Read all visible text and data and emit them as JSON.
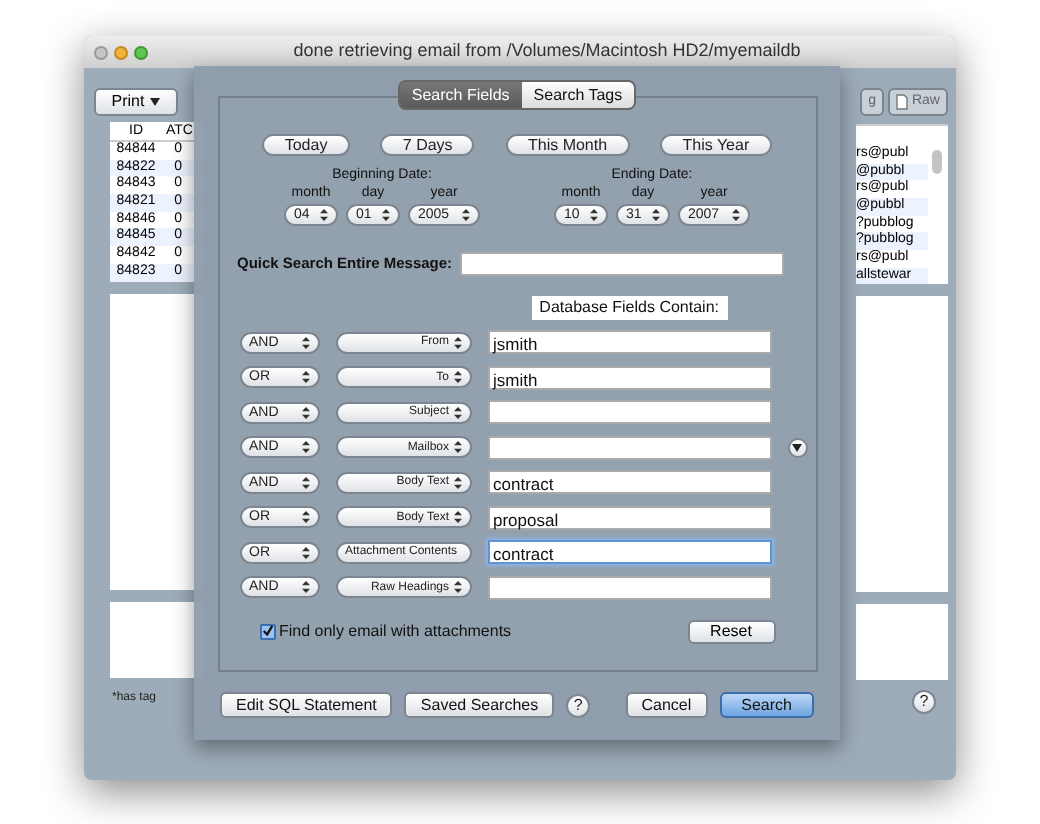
{
  "window": {
    "title": "done retrieving email from /Volumes/Macintosh HD2/myemaildb"
  },
  "toolbar": {
    "left_buttons": [
      {
        "label": "Print"
      }
    ],
    "right_buttons": [
      {
        "label": "g",
        "has_icon": false
      },
      {
        "label": "Raw",
        "has_icon": true
      }
    ]
  },
  "messages": {
    "columns": [
      "ID",
      "ATC"
    ],
    "rows": [
      {
        "id": "84844",
        "atc": "0",
        "column_3": "rs@publ"
      },
      {
        "id": "84822",
        "atc": "0",
        "column_3": "@pubbl"
      },
      {
        "id": "84843",
        "atc": "0",
        "column_3": "rs@publ"
      },
      {
        "id": "84821",
        "atc": "0",
        "column_3": "@pubbl"
      },
      {
        "id": "84846",
        "atc": "0",
        "column_3": "?pubblog"
      },
      {
        "id": "84845",
        "atc": "0",
        "column_3": "?pubblog"
      },
      {
        "id": "84842",
        "atc": "0",
        "column_3": "rs@publ"
      },
      {
        "id": "84823",
        "atc": "0",
        "column_3": "allstewar"
      }
    ]
  },
  "footnote": "*has tag",
  "help_button": "?",
  "sheet": {
    "tabs": [
      {
        "label": "Search Fields",
        "selected": true
      },
      {
        "label": "Search Tags",
        "selected": false
      }
    ],
    "quick_dates": [
      "Today",
      "7 Days",
      "This Month",
      "This Year"
    ],
    "date_ranges": [
      {
        "title": "Beginning Date:",
        "parts": [
          {
            "label": "month",
            "value": "04"
          },
          {
            "label": "day",
            "value": "01"
          },
          {
            "label": "year",
            "value": "2005"
          }
        ]
      },
      {
        "title": "Ending Date:",
        "parts": [
          {
            "label": "month",
            "value": "10"
          },
          {
            "label": "day",
            "value": "31"
          },
          {
            "label": "year",
            "value": "2007"
          }
        ]
      }
    ],
    "quick_search": {
      "label": "Quick Search Entire Message:"
    },
    "fields_header": "Database Fields Contain:",
    "criteria": [
      {
        "kind": "text",
        "operator": "AND",
        "field": "From",
        "value": "jsmith",
        "focused": false
      },
      {
        "kind": "text",
        "operator": "OR",
        "field": "To",
        "value": "jsmith",
        "focused": false
      },
      {
        "kind": "text",
        "operator": "AND",
        "field": "Subject",
        "focused": false
      },
      {
        "kind": "menu",
        "operator": "AND",
        "field": "Mailbox",
        "focused": false
      },
      {
        "kind": "text",
        "operator": "AND",
        "field": "Body Text",
        "value": "contract",
        "focused": false
      },
      {
        "kind": "text",
        "operator": "OR",
        "field": "Body Text",
        "value": "proposal",
        "focused": false
      },
      {
        "kind": "text",
        "operator": "OR",
        "field": "Attachment Contents",
        "value": "contract",
        "focused": true
      },
      {
        "kind": "text",
        "operator": "AND",
        "field": "Raw Headings",
        "focused": false
      }
    ],
    "attachments_only": {
      "label": "Find only email with attachments",
      "checked": true
    },
    "reset_button": "Reset",
    "buttons": [
      {
        "label": "Edit SQL Statement",
        "kind": "normal"
      },
      {
        "label": "Saved Searches",
        "kind": "normal"
      },
      {
        "label": "?",
        "kind": "help"
      },
      {
        "label": "Cancel",
        "kind": "normal"
      },
      {
        "label": "Search",
        "kind": "default"
      }
    ]
  }
}
